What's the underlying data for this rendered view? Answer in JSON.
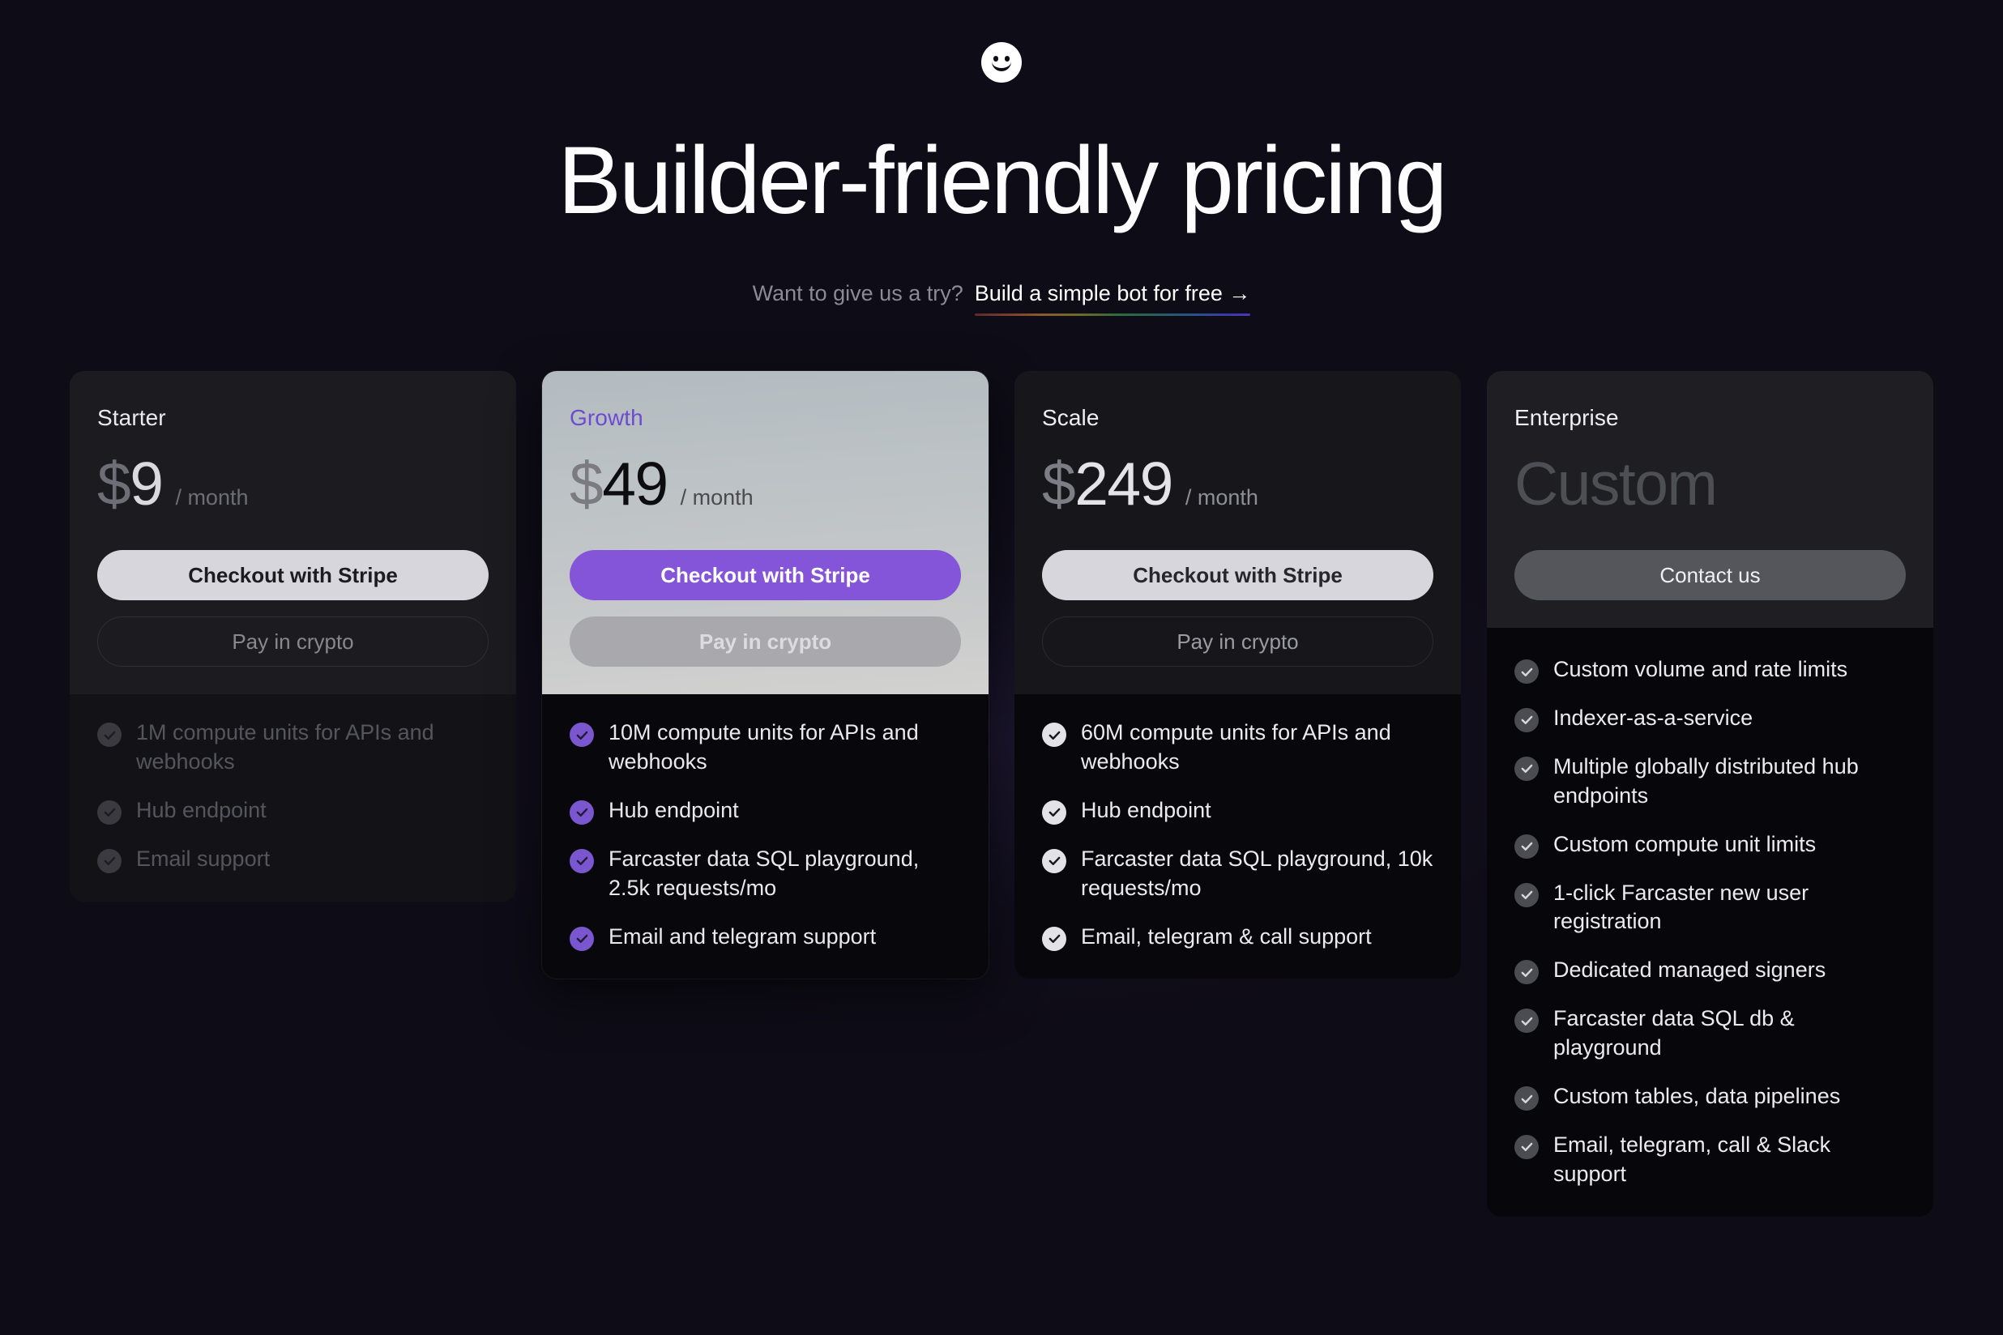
{
  "brand": {
    "logo_icon": "smiley-face-icon"
  },
  "header": {
    "title": "Builder-friendly pricing",
    "subtitle_lead": "Want to give us a try?",
    "cta_label": "Build a simple bot for free →"
  },
  "colors": {
    "page_background": "#0e0c16",
    "accent_purple": "#7b57cf",
    "growth_title": "#6d4bd1",
    "growth_button": "#8455d8",
    "light_button": "#d6d6dc",
    "enterprise_button": "#55555c"
  },
  "plans": [
    {
      "name": "Starter",
      "currency": "$",
      "amount": "9",
      "period": "/ month",
      "primary_button": "Checkout with Stripe",
      "secondary_button": "Pay in crypto",
      "features": [
        "1M compute units for APIs and webhooks",
        "Hub endpoint",
        "Email support"
      ]
    },
    {
      "name": "Growth",
      "currency": "$",
      "amount": "49",
      "period": "/ month",
      "primary_button": "Checkout with Stripe",
      "secondary_button": "Pay in crypto",
      "features": [
        "10M compute units for APIs and webhooks",
        "Hub endpoint",
        "Farcaster data SQL playground, 2.5k requests/mo",
        "Email and telegram support"
      ]
    },
    {
      "name": "Scale",
      "currency": "$",
      "amount": "249",
      "period": "/ month",
      "primary_button": "Checkout with Stripe",
      "secondary_button": "Pay in crypto",
      "features": [
        "60M compute units for APIs and webhooks",
        "Hub endpoint",
        "Farcaster data SQL playground, 10k requests/mo",
        "Email, telegram & call support"
      ]
    },
    {
      "name": "Enterprise",
      "amount": "Custom",
      "primary_button": "Contact us",
      "features": [
        "Custom volume and rate limits",
        "Indexer-as-a-service",
        "Multiple globally distributed hub endpoints",
        "Custom compute unit limits",
        "1-click Farcaster new user registration",
        "Dedicated managed signers",
        "Farcaster data SQL db & playground",
        "Custom tables, data pipelines",
        "Email, telegram, call & Slack support"
      ]
    }
  ]
}
